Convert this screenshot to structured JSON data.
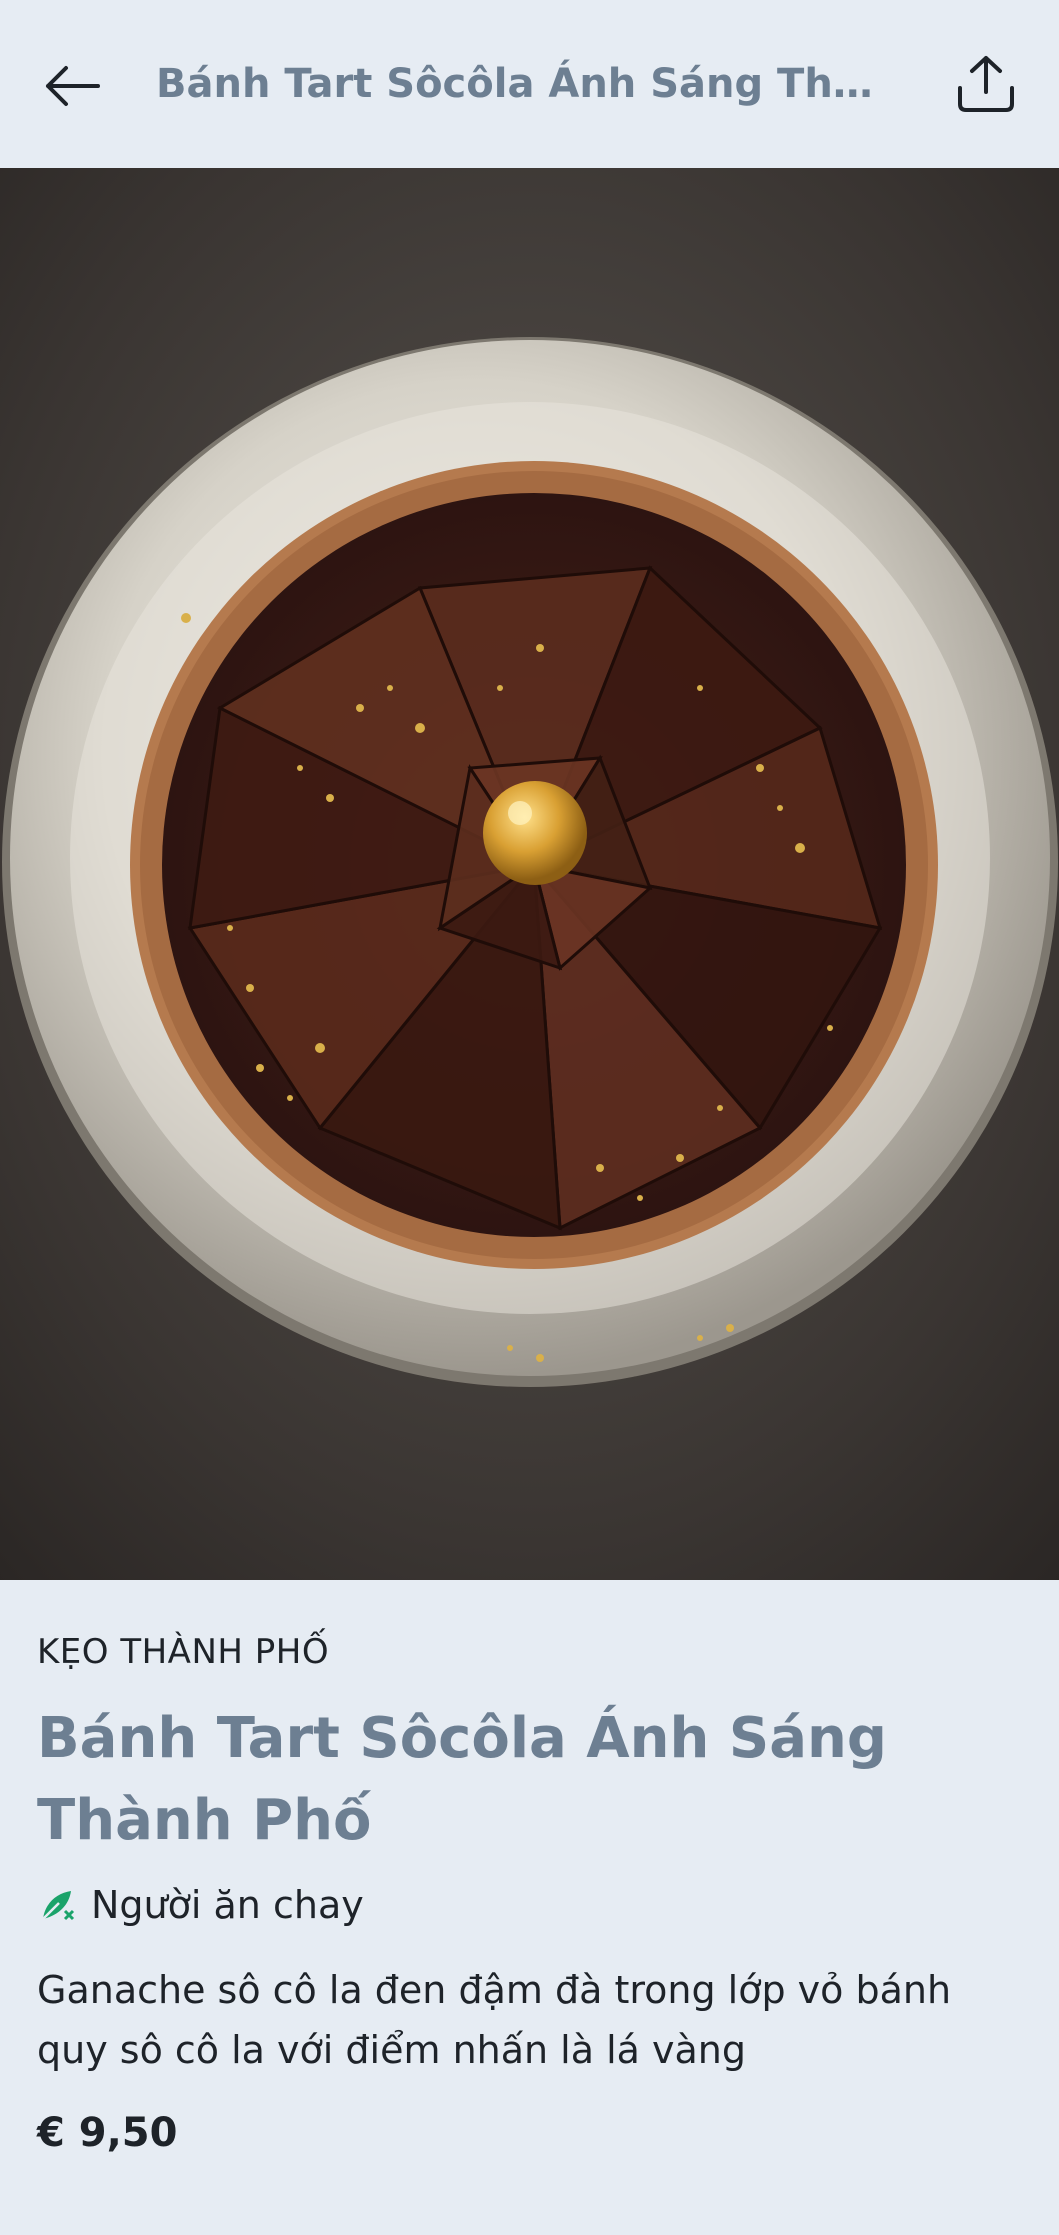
{
  "header": {
    "title": "Bánh Tart Sôcôla Ánh Sáng Thà...",
    "back_icon": "arrow-left-icon",
    "share_icon": "share-upload-icon"
  },
  "product": {
    "category": "KẸO THÀNH PHỐ",
    "title": "Bánh Tart Sôcôla Ánh Sáng Thành Phố",
    "diet_icon": "vegetarian-leaf-icon",
    "diet_label": "Người ăn chay",
    "description": "Ganache sô cô la đen đậm đà trong lớp vỏ bánh quy sô cô la với điểm nhấn là lá vàng",
    "price": "€ 9,50"
  },
  "colors": {
    "background": "#e6ecf3",
    "title": "#6d7f92",
    "text": "#1e2329",
    "diet_icon": "#1aa36a",
    "gold": "#d4a32c"
  }
}
